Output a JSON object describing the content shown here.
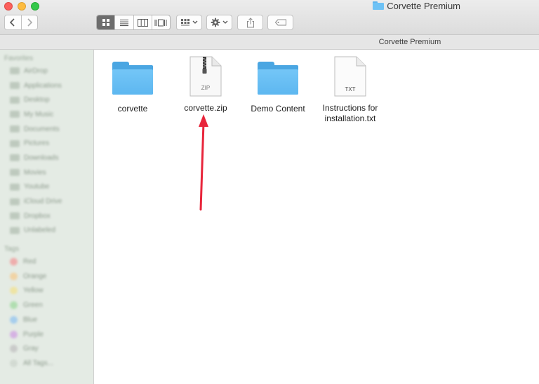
{
  "window": {
    "title": "Corvette Premium",
    "path_label": "Corvette Premium"
  },
  "toolbar": {
    "icons": [
      "chevron-left-icon",
      "chevron-right-icon",
      "icon-view-icon",
      "list-view-icon",
      "column-view-icon",
      "cover-flow-icon",
      "arrange-icon",
      "gear-icon",
      "share-icon",
      "tag-icon"
    ]
  },
  "sidebar": {
    "favorites_heading": "Favorites",
    "favorites": [
      "AirDrop",
      "Applications",
      "Desktop",
      "My Music",
      "Documents",
      "Pictures",
      "Downloads",
      "Movies",
      "Youtube",
      "iCloud Drive",
      "Dropbox",
      "Unlabeled"
    ],
    "tags_heading": "Tags",
    "tags": [
      {
        "label": "Red",
        "color": "#f0a3a3"
      },
      {
        "label": "Orange",
        "color": "#f3cf9a"
      },
      {
        "label": "Yellow",
        "color": "#f0e39a"
      },
      {
        "label": "Green",
        "color": "#a7dca7"
      },
      {
        "label": "Blue",
        "color": "#9cc9ef"
      },
      {
        "label": "Purple",
        "color": "#d3a9e3"
      },
      {
        "label": "Gray",
        "color": "#c5c5c5"
      },
      {
        "label": "All Tags...",
        "color": "#cfd7cf"
      }
    ]
  },
  "files": [
    {
      "name": "corvette",
      "kind": "folder"
    },
    {
      "name": "corvette.zip",
      "kind": "zip",
      "badge": "ZIP"
    },
    {
      "name": "Demo Content",
      "kind": "folder"
    },
    {
      "name": "Instructions for installation.txt",
      "kind": "text",
      "badge": "TXT"
    }
  ],
  "annotation": {
    "color": "#e8253b"
  }
}
